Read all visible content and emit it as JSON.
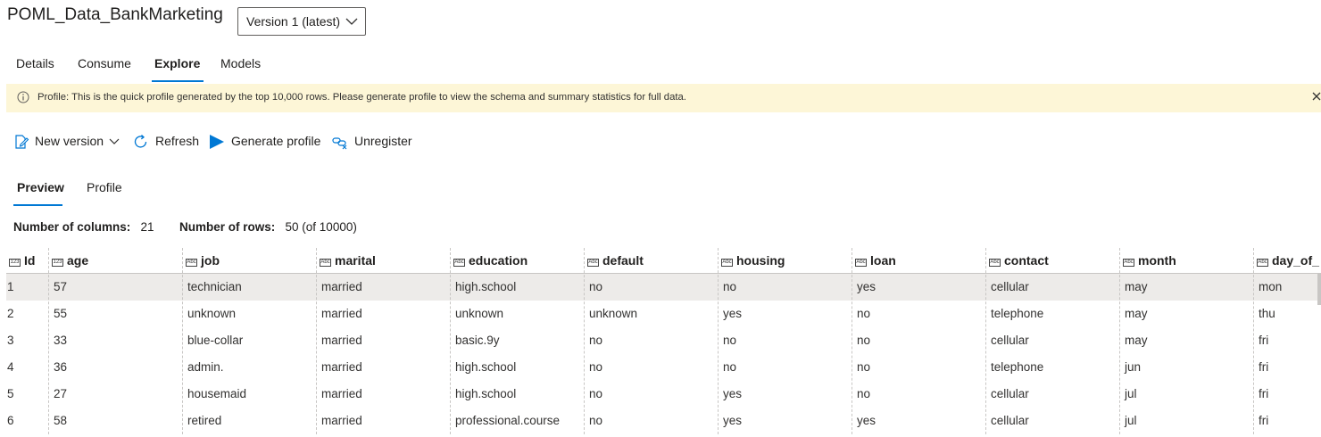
{
  "dataset_title": "POML_Data_BankMarketing",
  "version_select": {
    "value": "Version 1 (latest)"
  },
  "tabs": [
    {
      "label": "Details"
    },
    {
      "label": "Consume"
    },
    {
      "label": "Explore",
      "active": true
    },
    {
      "label": "Models"
    }
  ],
  "banner": {
    "text": "Profile: This is the quick profile generated by the top 10,000 rows. Please generate profile to view the schema and summary statistics for full data."
  },
  "toolbar": {
    "new_version": "New version",
    "refresh": "Refresh",
    "generate_profile": "Generate profile",
    "unregister": "Unregister"
  },
  "subtabs": [
    {
      "label": "Preview",
      "active": true
    },
    {
      "label": "Profile"
    }
  ],
  "stats": {
    "columns_label": "Number of columns:",
    "columns_value": "21",
    "rows_label": "Number of rows:",
    "rows_value": "50 (of 10000)"
  },
  "table": {
    "columns": [
      {
        "name": "Id",
        "type": "123"
      },
      {
        "name": "age",
        "type": "123"
      },
      {
        "name": "job",
        "type": "Abc"
      },
      {
        "name": "marital",
        "type": "Abc"
      },
      {
        "name": "education",
        "type": "Abc"
      },
      {
        "name": "default",
        "type": "Abc"
      },
      {
        "name": "housing",
        "type": "Abc"
      },
      {
        "name": "loan",
        "type": "Abc"
      },
      {
        "name": "contact",
        "type": "Abc"
      },
      {
        "name": "month",
        "type": "Abc"
      },
      {
        "name": "day_of_",
        "type": "Abc"
      }
    ],
    "rows": [
      [
        "1",
        "57",
        "technician",
        "married",
        "high.school",
        "no",
        "no",
        "yes",
        "cellular",
        "may",
        "mon"
      ],
      [
        "2",
        "55",
        "unknown",
        "married",
        "unknown",
        "unknown",
        "yes",
        "no",
        "telephone",
        "may",
        "thu"
      ],
      [
        "3",
        "33",
        "blue-collar",
        "married",
        "basic.9y",
        "no",
        "no",
        "no",
        "cellular",
        "may",
        "fri"
      ],
      [
        "4",
        "36",
        "admin.",
        "married",
        "high.school",
        "no",
        "no",
        "no",
        "telephone",
        "jun",
        "fri"
      ],
      [
        "5",
        "27",
        "housemaid",
        "married",
        "high.school",
        "no",
        "yes",
        "no",
        "cellular",
        "jul",
        "fri"
      ],
      [
        "6",
        "58",
        "retired",
        "married",
        "professional.course",
        "no",
        "yes",
        "yes",
        "cellular",
        "jul",
        "fri"
      ]
    ]
  },
  "colors": {
    "accent": "#0078d4",
    "banner_bg": "#fdf6d7",
    "selected_row": "#edebe9"
  }
}
